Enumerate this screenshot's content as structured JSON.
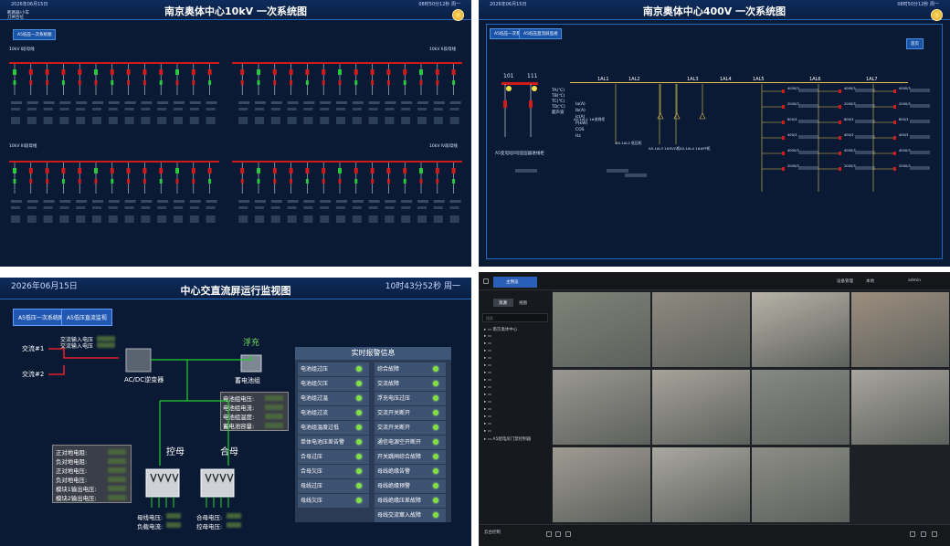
{
  "panel1": {
    "title": "南京奥体中心10kV 一次系统图",
    "date": "2026年06月15日",
    "time": "08时50分12秒 周一",
    "nav_button": "A5低压一次系统图",
    "legend": [
      "断路器/小车",
      "刀闸合位",
      "刀闸分位"
    ],
    "bus_upper_left": "10kV I段母线",
    "bus_upper_right": "10kV II段母线",
    "bus_lower_left": "10kV III段母线",
    "bus_lower_right": "10kV IV段母线"
  },
  "panel2": {
    "title": "南京奥体中心400V 一次系统图",
    "date": "2026年06月15日",
    "time": "08时50分12秒 周一",
    "nav_buttons": [
      "A5低压一次系统图",
      "A5低压直流屏监视"
    ],
    "right_button": "首页",
    "feeder_101": "101",
    "feeder_111": "111",
    "left_params": [
      "TA(℃)",
      "TB(℃)",
      "TC(℃)",
      "TD(℃)",
      "超声波"
    ],
    "left_params2": [
      "Ia(A)",
      "Ib(A)",
      "Ic(A)",
      "P(kW)",
      "COS",
      "Hz"
    ],
    "sections": [
      "1AL1",
      "1AL2",
      "1AL3",
      "1AL4",
      "1AL5",
      "1AL6",
      "1AL7"
    ],
    "trafo_labels": [
      "A5-1AL1 1#进线柜",
      "A5-1AL2 低压柜",
      "A5-1AL3 1#SVG柜",
      "A5-1AL4 1#APF柜"
    ],
    "breaker_labels": [
      "4000/3",
      "2000/3",
      "800/3",
      "400/3"
    ],
    "bottom_left": "A5变电站1号变压器进线柜"
  },
  "panel3": {
    "title": "中心交直流屏运行监视图",
    "date": "2026年06月15日",
    "time": "10时43分52秒 周一",
    "nav_buttons": [
      "A5低压一次系统图",
      "A5低压直流监视"
    ],
    "ac_in": [
      "交流#1",
      "交流#2"
    ],
    "ac_voltage": [
      "交流输入电压",
      "交流输入电压"
    ],
    "inverter_label": "AC/DC逆变器",
    "float_label": "浮充",
    "battery_label": "蓄电池组",
    "battery_params": [
      "电池组电压:",
      "电池组电流:",
      "电池组温度:",
      "蓄电池容量:"
    ],
    "bus_ctrl": "控母",
    "bus_close": "合母",
    "left_params": [
      "正对地电阻:",
      "负对地电阻:",
      "正对地电压:",
      "负对地电压:",
      "模块1输出电压:",
      "模块2输出电压:"
    ],
    "bottom_params": [
      "母线电压:",
      "负载电流:",
      "合母电压:",
      "控母电压:"
    ],
    "alarm_title": "实时报警信息",
    "alarms_left": [
      "电池组过压",
      "电池组欠压",
      "电池组过温",
      "电池组过流",
      "电池组温度过低",
      "单体电池压差告警",
      "合母过压",
      "合母欠压",
      "母线过压",
      "母线欠压"
    ],
    "alarms_right": [
      "综合故障",
      "交流故障",
      "浮充电压过压",
      "交流开关断开",
      "交流开关断开",
      "通信电源空开断开",
      "开关跳闸综合故障",
      "母线绝缘告警",
      "母线绝缘预警",
      "母线绝缘压差故障",
      "母线交流窜入故障"
    ]
  },
  "panel4": {
    "tab": "主预览",
    "tabs": [
      "资源",
      "视图"
    ],
    "search_placeholder": "搜索",
    "tree": [
      "南京奥体中心",
      "",
      "",
      "",
      "",
      "",
      "",
      "",
      "",
      "",
      "",
      "",
      "",
      "",
      "",
      "A5配电房门禁控制器"
    ],
    "status_text": "云台控制",
    "top_buttons": [
      "设备管理",
      "本地"
    ],
    "user": "admin"
  },
  "colors": {
    "bus_red": "#d01b1b",
    "bus_yellow": "#e2c44a",
    "header_blue": "#1f6bbd",
    "ok_green": "#7fe043"
  }
}
